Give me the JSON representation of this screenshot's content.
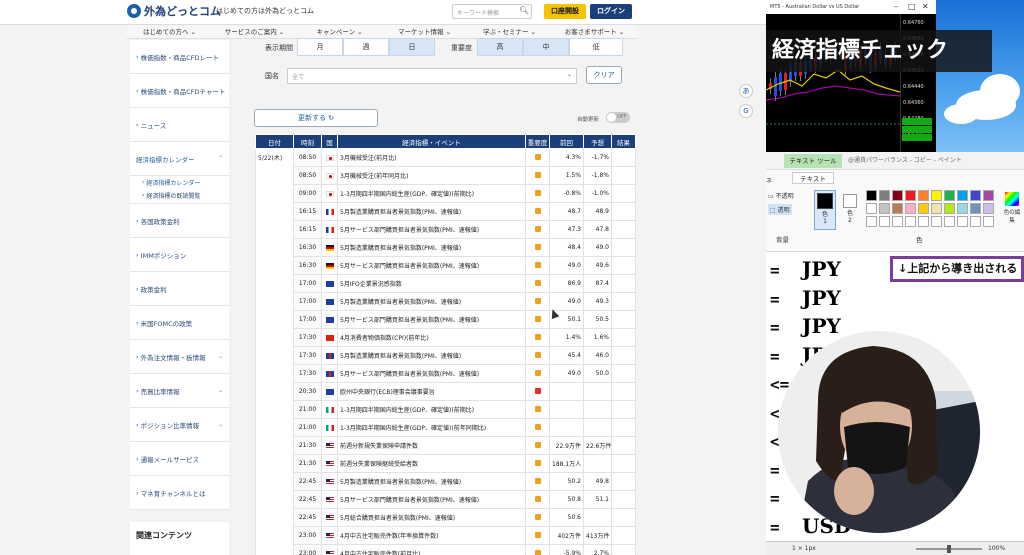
{
  "site": {
    "logo": "外為どっとコム",
    "tagline": "はじめての方は外為どっとコム",
    "search_placeholder": "キーワード検索",
    "account_button": "口座開設",
    "login_button": "ログイン",
    "nav": [
      "はじめての方へ",
      "サービスのご案内",
      "キャンペーン",
      "マーケット情報",
      "学ぶ・セミナー",
      "お客さまサポート"
    ]
  },
  "sidebar": {
    "items": [
      "株価指数・商品CFDレート",
      "株価指数・商品CFDチャート",
      "ニュース",
      "経済指標カレンダー",
      "経済指標カレンダー",
      "経済指標の既読閲覧",
      "各国政策金利",
      "IMMポジション",
      "政策金利",
      "米国FOMCの政策",
      "外為注文情報・板情報",
      "売買比率情報",
      "ポジション比率情報",
      "通報メールサービス",
      "マネ育チャンネルとは"
    ],
    "related": "関連コンテンツ"
  },
  "filters": {
    "period_label": "表示期間",
    "period": [
      "月",
      "週",
      "日"
    ],
    "importance_label": "重要度",
    "importance": [
      "高",
      "中",
      "低"
    ],
    "country_label": "国名",
    "country_placeholder": "全て",
    "clear_button": "クリア",
    "refresh_button": "更新する ↻",
    "auto_update": "自動更新",
    "toggle_state": "OFF"
  },
  "table": {
    "headers": [
      "日付",
      "時刻",
      "国",
      "経済指標・イベント",
      "重要度",
      "前回",
      "予想",
      "結果"
    ],
    "date": "5/22(木)",
    "rows": [
      {
        "time": "08:50",
        "flag": "JP",
        "event": "3月機械受注(前月比)",
        "imp": "mid",
        "prev": "4.3%",
        "fc": "-1.7%"
      },
      {
        "time": "08:50",
        "flag": "JP",
        "event": "3月機械受注(前年同月比)",
        "imp": "mid",
        "prev": "1.5%",
        "fc": "-1.8%"
      },
      {
        "time": "09:00",
        "flag": "JP",
        "event": "1-3月期四半期国内総生産(GDP、確定値)(前期比)",
        "imp": "mid",
        "prev": "-0.8%",
        "fc": "-1.0%"
      },
      {
        "time": "16:15",
        "flag": "FR",
        "event": "5月製造業購買担当者景気指数(PMI、速報値)",
        "imp": "mid",
        "prev": "48.7",
        "fc": "48.9"
      },
      {
        "time": "16:15",
        "flag": "FR",
        "event": "5月サービス部門購買担当者景気指数(PMI、速報値)",
        "imp": "mid",
        "prev": "47.3",
        "fc": "47.8"
      },
      {
        "time": "16:30",
        "flag": "DE",
        "event": "5月製造業購買担当者景気指数(PMI、速報値)",
        "imp": "mid",
        "prev": "48.4",
        "fc": "49.0"
      },
      {
        "time": "16:30",
        "flag": "DE",
        "event": "5月サービス部門購買担当者景気指数(PMI、速報値)",
        "imp": "mid",
        "prev": "49.0",
        "fc": "49.6"
      },
      {
        "time": "17:00",
        "flag": "EU",
        "event": "5月IFO企業景況感指数",
        "imp": "mid",
        "prev": "86.9",
        "fc": "87.4"
      },
      {
        "time": "17:00",
        "flag": "EU",
        "event": "5月製造業購買担当者景気指数(PMI、速報値)",
        "imp": "mid",
        "prev": "49.0",
        "fc": "49.3"
      },
      {
        "time": "17:00",
        "flag": "EU",
        "event": "5月サービス部門購買担当者景気指数(PMI、速報値)",
        "imp": "mid",
        "prev": "50.1",
        "fc": "50.5"
      },
      {
        "time": "17:30",
        "flag": "CH",
        "event": "4月消費者物価指数(CPI)(前年比)",
        "imp": "mid",
        "prev": "1.4%",
        "fc": "1.6%"
      },
      {
        "time": "17:30",
        "flag": "GB",
        "event": "5月製造業購買担当者景気指数(PMI、速報値)",
        "imp": "mid",
        "prev": "45.4",
        "fc": "46.0"
      },
      {
        "time": "17:30",
        "flag": "GB",
        "event": "5月サービス部門購買担当者景気指数(PMI、速報値)",
        "imp": "mid",
        "prev": "49.0",
        "fc": "50.0"
      },
      {
        "time": "20:30",
        "flag": "EU",
        "event": "欧州中央銀行(ECB)理事会議事要旨",
        "imp": "hi",
        "prev": "",
        "fc": ""
      },
      {
        "time": "21:00",
        "flag": "IT",
        "event": "1-3月期四半期国内総生産(GDP、確定値)(前期比)",
        "imp": "mid",
        "prev": "",
        "fc": ""
      },
      {
        "time": "21:00",
        "flag": "IT",
        "event": "1-3月期四半期国内総生産(GDP、確定値)(前年同期比)",
        "imp": "mid",
        "prev": "",
        "fc": ""
      },
      {
        "time": "21:30",
        "flag": "US",
        "event": "前週分新規失業保険申請件数",
        "imp": "mid",
        "prev": "22.9万件",
        "fc": "22.6万件"
      },
      {
        "time": "21:30",
        "flag": "US",
        "event": "前週分失業保険継続受給者数",
        "imp": "mid",
        "prev": "188.1万人",
        "fc": ""
      },
      {
        "time": "22:45",
        "flag": "US",
        "event": "5月製造業購買担当者景気指数(PMI、速報値)",
        "imp": "mid",
        "prev": "50.2",
        "fc": "49.8"
      },
      {
        "time": "22:45",
        "flag": "US",
        "event": "5月サービス部門購買担当者景気指数(PMI、速報値)",
        "imp": "mid",
        "prev": "50.8",
        "fc": "51.1"
      },
      {
        "time": "22:45",
        "flag": "US",
        "event": "5月総合購買担当者景気指数(PMI、速報値)",
        "imp": "mid",
        "prev": "50.6",
        "fc": ""
      },
      {
        "time": "23:00",
        "flag": "US",
        "event": "4月中古住宅販売件数(年率換算件数)",
        "imp": "mid",
        "prev": "402万件",
        "fc": "413万件"
      },
      {
        "time": "23:00",
        "flag": "US",
        "event": "4月中古住宅販売件数(前月比)",
        "imp": "mid",
        "prev": "-5.9%",
        "fc": "2.7%"
      }
    ]
  },
  "trading": {
    "title": "MT5 - Australian Dollar vs US Dollar",
    "prices": [
      "0.64760",
      "0.64680",
      "0.64600",
      "0.64520",
      "0.64440",
      "0.64360",
      "0.64280",
      "0.64200"
    ]
  },
  "caption": "経済指標チェック",
  "paint": {
    "tab_text_tool": "テキスト ツール",
    "window_title": "@通貨パワーバランス - コピー - ペイント",
    "tab_text": "テキスト",
    "group_left_top": "ネ",
    "opaque": "不透明",
    "transparent": "透明",
    "group_background": "背景",
    "color1": "色\n1",
    "color2": "色\n2",
    "edit_colors": "色の編集",
    "group_color": "色",
    "note": "↓上記から導き出される",
    "lines": [
      {
        "op": "=",
        "cur": "JPY"
      },
      {
        "op": "=",
        "cur": "JPY"
      },
      {
        "op": "=",
        "cur": "JPY"
      },
      {
        "op": "=",
        "cur": "JPY"
      },
      {
        "op": "<=",
        "cur": ""
      },
      {
        "op": "<",
        "cur": ""
      },
      {
        "op": "<",
        "cur": ""
      },
      {
        "op": "=",
        "cur": ""
      },
      {
        "op": "=",
        "cur": ""
      },
      {
        "op": "=",
        "cur": "USD"
      }
    ],
    "status_size": "1 × 1px",
    "status_zoom": "100%"
  }
}
